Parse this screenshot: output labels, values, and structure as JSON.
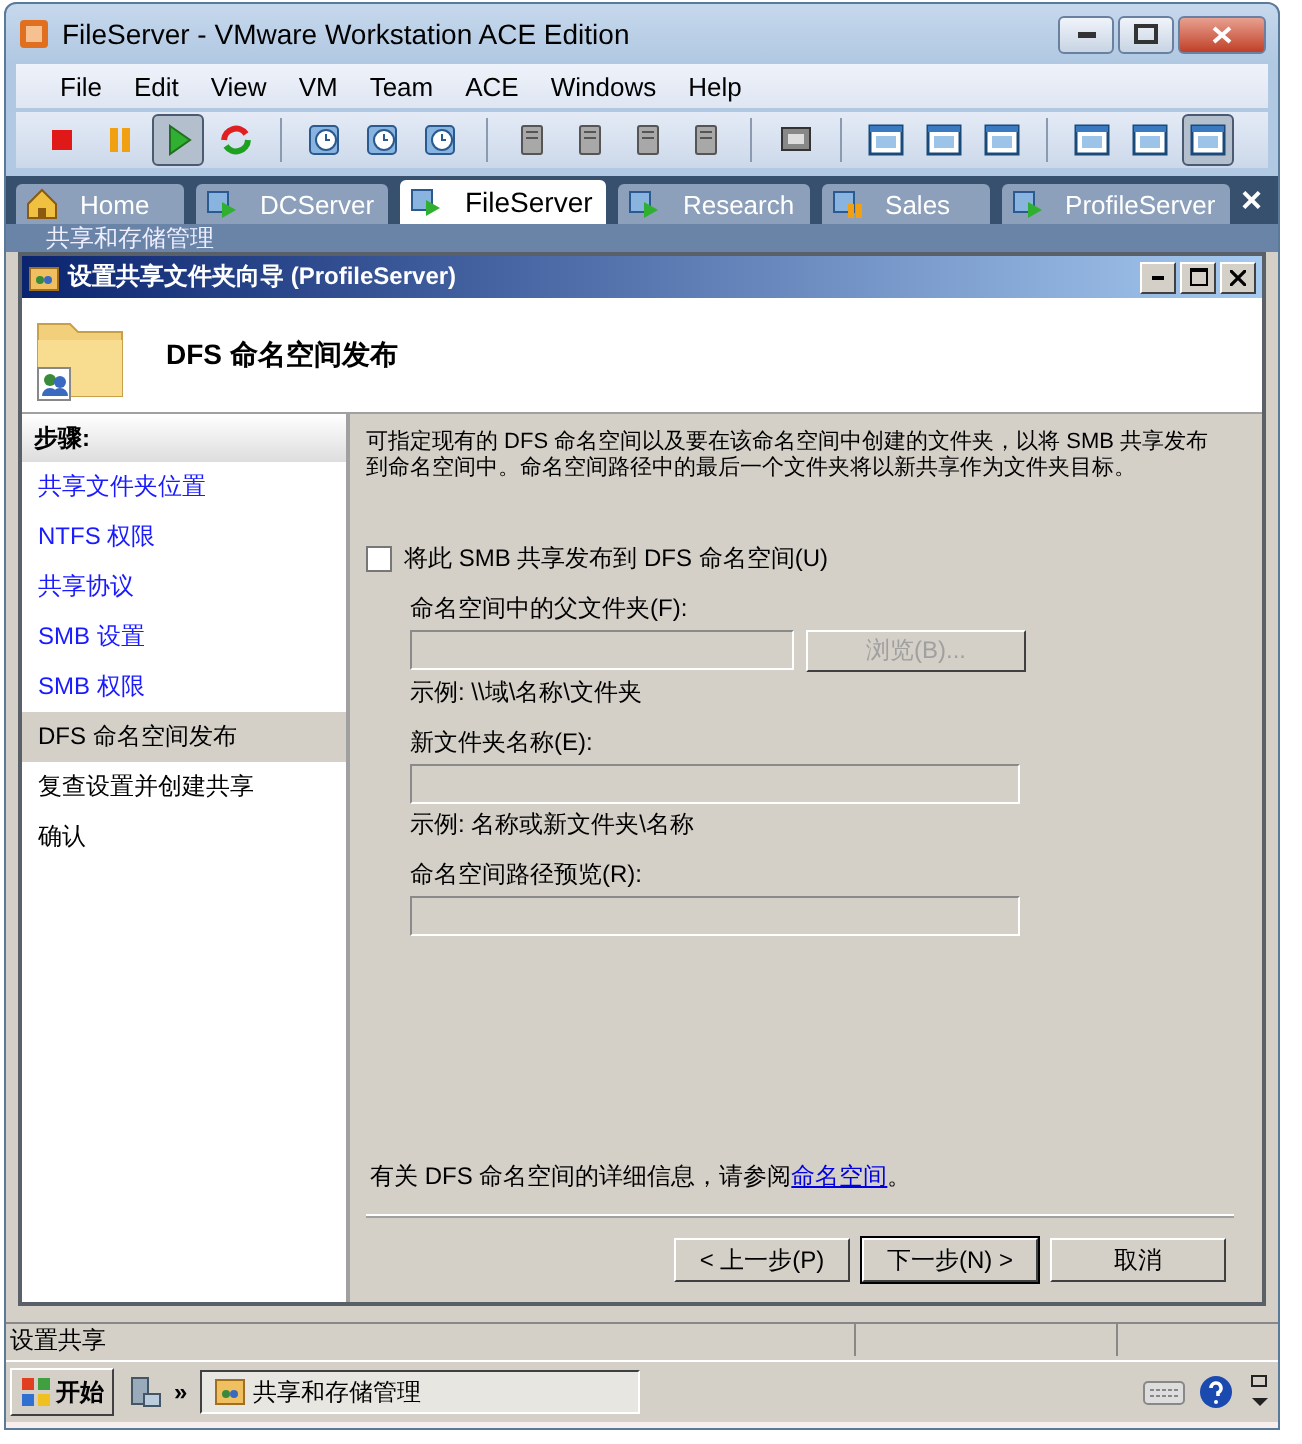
{
  "window": {
    "title": "FileServer - VMware Workstation ACE Edition"
  },
  "menu": [
    "File",
    "Edit",
    "View",
    "VM",
    "Team",
    "ACE",
    "Windows",
    "Help"
  ],
  "toolbar": [
    {
      "buttons": [
        {
          "kind": "stop",
          "pressed": false
        },
        {
          "kind": "pause",
          "pressed": false
        },
        {
          "kind": "play",
          "pressed": true
        },
        {
          "kind": "reset",
          "pressed": false
        }
      ]
    },
    {
      "buttons": [
        {
          "kind": "clock",
          "pressed": false
        },
        {
          "kind": "clock",
          "pressed": false
        },
        {
          "kind": "clock",
          "pressed": false
        }
      ]
    },
    {
      "buttons": [
        {
          "kind": "server",
          "pressed": false
        },
        {
          "kind": "server",
          "pressed": false
        },
        {
          "kind": "server",
          "pressed": false
        },
        {
          "kind": "server",
          "pressed": false
        }
      ]
    },
    {
      "buttons": [
        {
          "kind": "monitor",
          "pressed": false
        }
      ]
    },
    {
      "buttons": [
        {
          "kind": "window",
          "pressed": false
        },
        {
          "kind": "window",
          "pressed": false
        },
        {
          "kind": "window",
          "pressed": false
        }
      ]
    },
    {
      "buttons": [
        {
          "kind": "window",
          "pressed": false
        },
        {
          "kind": "window",
          "pressed": false
        },
        {
          "kind": "window",
          "pressed": true
        }
      ]
    }
  ],
  "tabs": [
    {
      "label": "Home",
      "kind": "home",
      "selected": false
    },
    {
      "label": "DCServer",
      "kind": "running",
      "selected": false
    },
    {
      "label": "FileServer",
      "kind": "running",
      "selected": true
    },
    {
      "label": "Research",
      "kind": "running",
      "selected": false
    },
    {
      "label": "Sales",
      "kind": "paused",
      "selected": false
    },
    {
      "label": "ProfileServer",
      "kind": "running",
      "selected": false
    }
  ],
  "tab_close": "×",
  "mmc_window": {
    "title": "共享和存储管理",
    "status": "设置共享"
  },
  "wizard": {
    "title": "设置共享文件夹向导 (ProfileServer)",
    "heading": "DFS 命名空间发布",
    "steps_title": "步骤:",
    "steps": [
      {
        "label": "共享文件夹位置",
        "visited": true,
        "selected": false
      },
      {
        "label": "NTFS 权限",
        "visited": true,
        "selected": false
      },
      {
        "label": "共享协议",
        "visited": true,
        "selected": false
      },
      {
        "label": "SMB 设置",
        "visited": true,
        "selected": false
      },
      {
        "label": "SMB 权限",
        "visited": true,
        "selected": false
      },
      {
        "label": "DFS 命名空间发布",
        "visited": false,
        "selected": true
      },
      {
        "label": "复查设置并创建共享",
        "visited": false,
        "selected": false
      },
      {
        "label": "确认",
        "visited": false,
        "selected": false
      }
    ],
    "description": "可指定现有的 DFS 命名空间以及要在该命名空间中创建的文件夹，以将 SMB 共享发布到命名空间中。命名空间路径中的最后一个文件夹将以新共享作为文件夹目标。",
    "publish_checkbox": {
      "label": "将此 SMB 共享发布到 DFS 命名空间(U)",
      "checked": false
    },
    "fields": [
      {
        "label": "命名空间中的父文件夹(F):",
        "example": "示例: \\\\域\\名称\\文件夹",
        "button": "浏览(B)...",
        "disabled": true
      },
      {
        "label": "新文件夹名称(E):",
        "example": "示例: 名称或新文件夹\\名称",
        "disabled": true
      },
      {
        "label": "命名空间路径预览(R):",
        "disabled": true
      }
    ],
    "info": {
      "text": "有关 DFS 命名空间的详细信息，请参阅",
      "link": "命名空间",
      "end": "。"
    },
    "buttons": [
      {
        "label": "< 上一步(P)",
        "default": false
      },
      {
        "label": "下一步(N) >",
        "default": true
      },
      {
        "label": "取消",
        "default": false
      }
    ]
  },
  "taskbar": {
    "start": "开始",
    "chevron": "»",
    "task": "共享和存储管理"
  }
}
